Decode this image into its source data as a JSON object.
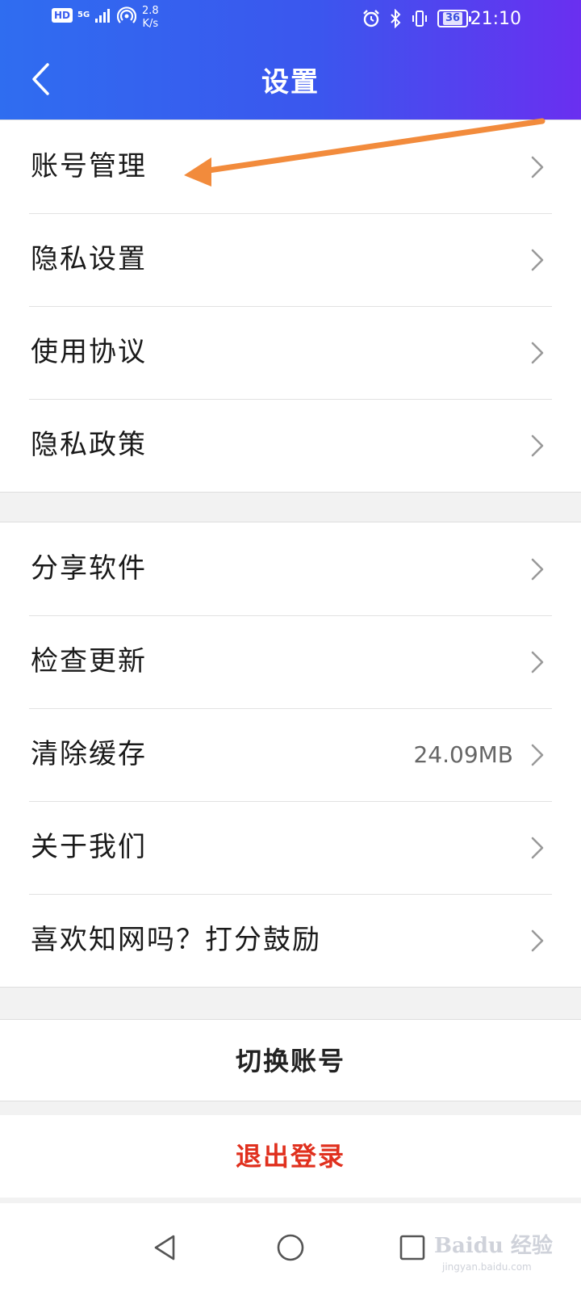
{
  "status_bar": {
    "hd": "HD",
    "network": "5G",
    "speed_value": "2.8",
    "speed_unit": "K/s",
    "battery": "36",
    "time": "21:10"
  },
  "header": {
    "title": "设置"
  },
  "groups": [
    {
      "items": [
        {
          "label": "账号管理"
        },
        {
          "label": "隐私设置"
        },
        {
          "label": "使用协议"
        },
        {
          "label": "隐私政策"
        }
      ]
    },
    {
      "items": [
        {
          "label": "分享软件"
        },
        {
          "label": "检查更新"
        },
        {
          "label": "清除缓存",
          "value": "24.09MB"
        },
        {
          "label": "关于我们"
        },
        {
          "label": "喜欢知网吗？打分鼓励"
        }
      ]
    }
  ],
  "actions": {
    "switch_account": "切换账号",
    "logout": "退出登录"
  },
  "colors": {
    "logout": "#e0301e",
    "annotation_arrow": "#f28b3c"
  },
  "watermark": {
    "brand": "Baidu 经验",
    "site": "jingyan.baidu.com"
  }
}
